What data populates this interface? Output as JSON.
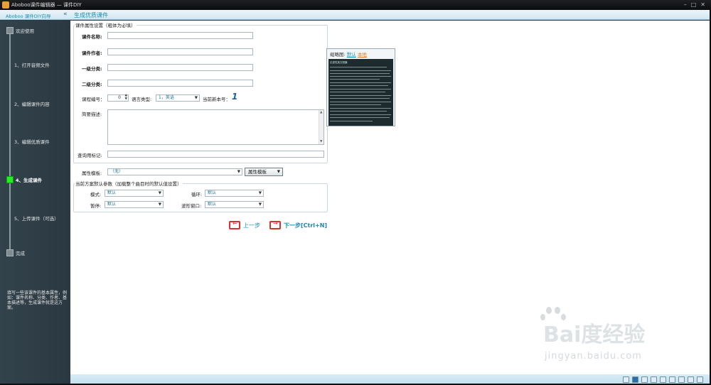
{
  "window": {
    "title": "Aboboo课件编辑器 — 课件DIY"
  },
  "nav": {
    "brand": "Aboboo 课件DIY向导",
    "collapse": "«",
    "current": "生成优质课件"
  },
  "steps": [
    {
      "label": "欢迎使用"
    },
    {
      "label": "1、打开音频文件"
    },
    {
      "label": "2、编辑课件内容"
    },
    {
      "label": "3、编辑优质课件"
    },
    {
      "label": "4、生成课件",
      "active": true
    },
    {
      "label": "5、上传课件（可选）"
    },
    {
      "label": "完成"
    }
  ],
  "help_text": "填写一些该课件的基本属性，例如：课件名称、分类、作者、基本描述等，生成课件就是这方案。",
  "props": {
    "legend": "课件属性设置（粗体为必填）",
    "name_label": "课件名称:",
    "author_label": "课件作者:",
    "cat1_label": "一级分类:",
    "cat2_label": "二级分类:",
    "course_no_label": "课程编号：",
    "course_no_value": "0",
    "lang_label": "语言类型:",
    "lang_value": "1，英语",
    "version_label": "当前新本号：",
    "version_value": "1",
    "desc_label": "简要描述:",
    "tag_label": "查询用标记:"
  },
  "thumb": {
    "label": "缩略图:",
    "link_default": "默认",
    "link_local": "本地",
    "preview_title": "论述性英文短篇"
  },
  "template": {
    "label": "属性模板:",
    "value": "（无）",
    "button": "属性模板"
  },
  "defaults": {
    "legend": "当前方案默认参数（加载整个曲目时的默认值设置）",
    "mode_label": "模式:",
    "mode_value": "默认",
    "loop_label": "循环:",
    "loop_value": "默认",
    "pause_label": "暂停:",
    "pause_value": "默认",
    "wave_label": "波形窗口:",
    "wave_value": "默认"
  },
  "actions": {
    "prev": "上一步",
    "next": "下一步[Ctrl+N]"
  },
  "watermark": {
    "text": "Bai度经验",
    "url": "jingyan.baidu.com"
  },
  "colors": {
    "accent": "#1b8fb4",
    "active_step": "#22ee22",
    "sidebar": "#2f3e47"
  }
}
